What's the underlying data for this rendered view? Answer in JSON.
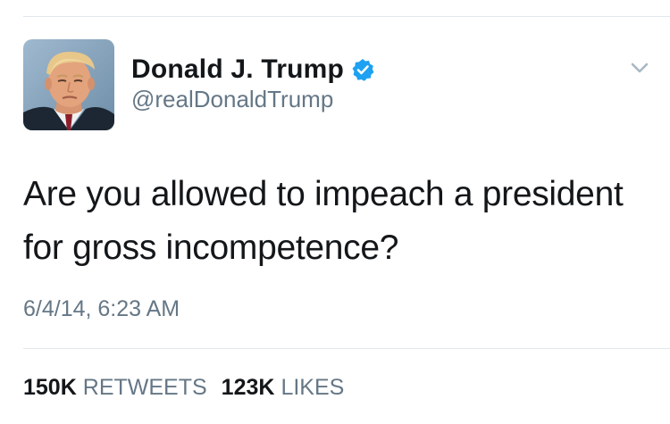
{
  "tweet": {
    "display_name": "Donald J. Trump",
    "handle": "@realDonaldTrump",
    "verified": true,
    "text": "Are you allowed to impeach a president for gross incompetence?",
    "timestamp": "6/4/14, 6:23 AM",
    "stats": {
      "retweets_count": "150K",
      "retweets_label": "RETWEETS",
      "likes_count": "123K",
      "likes_label": "LIKES"
    }
  },
  "icons": {
    "verified": "verified-badge-icon",
    "menu": "chevron-down-icon"
  },
  "colors": {
    "text_primary": "#14171a",
    "text_secondary": "#657786",
    "verified_blue": "#1da1f2",
    "divider": "#e1e8ed"
  }
}
